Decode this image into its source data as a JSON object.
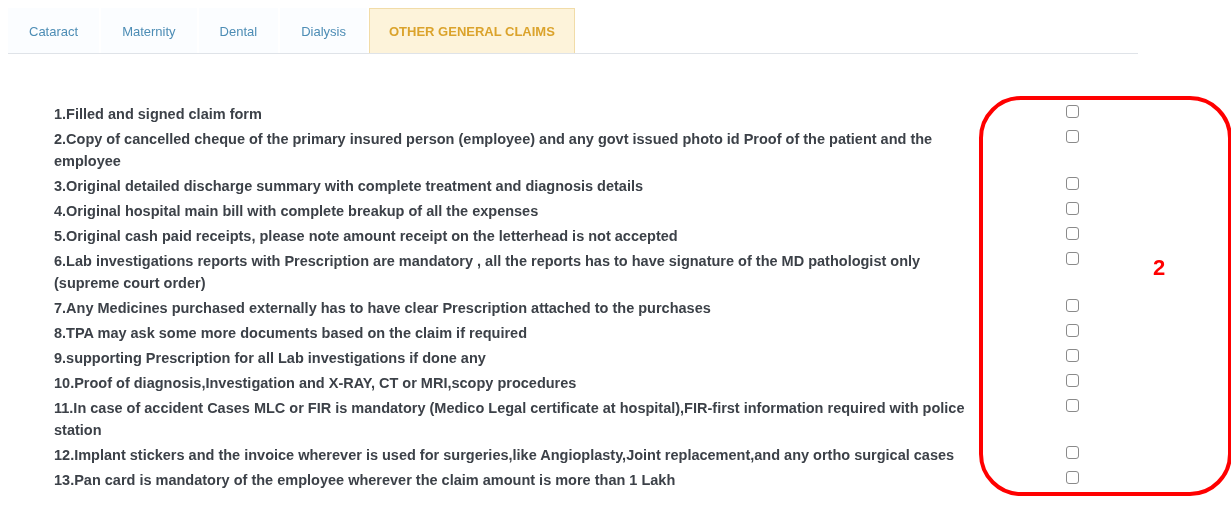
{
  "tabs": [
    {
      "label": "Cataract",
      "selected": false
    },
    {
      "label": "Maternity",
      "selected": false
    },
    {
      "label": "Dental",
      "selected": false
    },
    {
      "label": "Dialysis",
      "selected": false
    },
    {
      "label": "OTHER GENERAL CLAIMS",
      "selected": true
    }
  ],
  "checklist": [
    {
      "text": "1.Filled and signed claim form",
      "checked": false
    },
    {
      "text": "2.Copy of cancelled cheque of the primary insured person (employee) and any govt issued photo id Proof of the patient and the employee",
      "checked": false
    },
    {
      "text": "3.Original detailed discharge summary  with complete treatment and diagnosis details",
      "checked": false
    },
    {
      "text": "4.Original hospital main bill with complete breakup of all the expenses",
      "checked": false
    },
    {
      "text": "5.Original cash paid receipts, please note amount receipt on the letterhead is not accepted",
      "checked": false
    },
    {
      "text": "6.Lab investigations reports with Prescription are mandatory , all the reports has to have signature of the MD pathologist only (supreme court order)",
      "checked": false
    },
    {
      "text": "7.Any Medicines purchased externally  has to have clear Prescription attached to the purchases",
      "checked": false
    },
    {
      "text": "8.TPA may ask some more documents based on the claim if required",
      "checked": false
    },
    {
      "text": "9.supporting Prescription for all Lab investigations if done any",
      "checked": false
    },
    {
      "text": "10.Proof of diagnosis,Investigation and X-RAY, CT or MRI,scopy procedures",
      "checked": false
    },
    {
      "text": "11.In case of accident  Cases MLC or FIR is mandatory (Medico Legal certificate at hospital),FIR-first information required with police station",
      "checked": false
    },
    {
      "text": "12.Implant stickers and the invoice wherever is used for surgeries,like Angioplasty,Joint replacement,and any ortho surgical cases",
      "checked": false
    },
    {
      "text": "13.Pan card is mandatory of the employee wherever the claim amount is more than 1 Lakh",
      "checked": false
    }
  ],
  "annotation": {
    "label": "2"
  }
}
